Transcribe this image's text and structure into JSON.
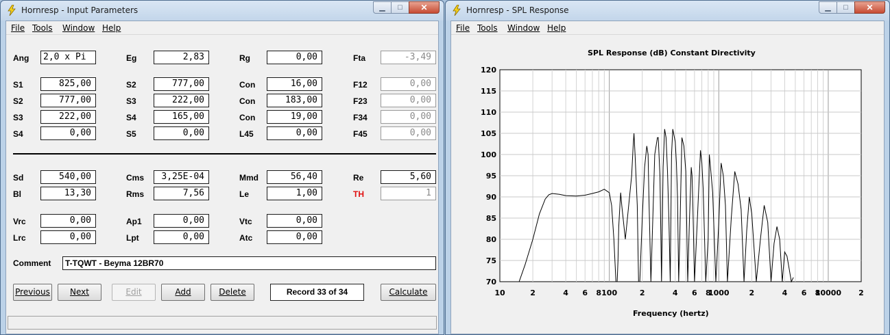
{
  "left_window": {
    "title": "Hornresp - Input Parameters",
    "menu": [
      "File",
      "Tools",
      "Window",
      "Help"
    ],
    "rows": [
      [
        {
          "label": "Ang",
          "value": "2,0 x Pi",
          "align": "left"
        },
        {
          "label": "Eg",
          "value": "2,83"
        },
        {
          "label": "Rg",
          "value": "0,00"
        },
        {
          "label": "Fta",
          "value": "-3,49",
          "disabled": true
        }
      ],
      [
        {
          "label": "S1",
          "value": "825,00"
        },
        {
          "label": "S2",
          "value": "777,00"
        },
        {
          "label": "Con",
          "value": "16,00"
        },
        {
          "label": "F12",
          "value": "0,00",
          "disabled": true
        }
      ],
      [
        {
          "label": "S2",
          "value": "777,00"
        },
        {
          "label": "S3",
          "value": "222,00"
        },
        {
          "label": "Con",
          "value": "183,00"
        },
        {
          "label": "F23",
          "value": "0,00",
          "disabled": true
        }
      ],
      [
        {
          "label": "S3",
          "value": "222,00"
        },
        {
          "label": "S4",
          "value": "165,00"
        },
        {
          "label": "Con",
          "value": "19,00"
        },
        {
          "label": "F34",
          "value": "0,00",
          "disabled": true
        }
      ],
      [
        {
          "label": "S4",
          "value": "0,00"
        },
        {
          "label": "S5",
          "value": "0,00"
        },
        {
          "label": "L45",
          "value": "0,00"
        },
        {
          "label": "F45",
          "value": "0,00",
          "disabled": true
        }
      ],
      [
        {
          "label": "Sd",
          "value": "540,00"
        },
        {
          "label": "Cms",
          "value": "3,25E-04"
        },
        {
          "label": "Mmd",
          "value": "56,40"
        },
        {
          "label": "Re",
          "value": "5,60"
        }
      ],
      [
        {
          "label": "Bl",
          "value": "13,30"
        },
        {
          "label": "Rms",
          "value": "7,56"
        },
        {
          "label": "Le",
          "value": "1,00"
        },
        {
          "label": "TH",
          "value": "1",
          "disabled": true,
          "red": true
        }
      ],
      [
        {
          "label": "Vrc",
          "value": "0,00"
        },
        {
          "label": "Ap1",
          "value": "0,00"
        },
        {
          "label": "Vtc",
          "value": "0,00"
        }
      ],
      [
        {
          "label": "Lrc",
          "value": "0,00"
        },
        {
          "label": "Lpt",
          "value": "0,00"
        },
        {
          "label": "Atc",
          "value": "0,00"
        }
      ]
    ],
    "comment_label": "Comment",
    "comment_value": "T-TQWT - Beyma 12BR70",
    "buttons": {
      "previous": "Previous",
      "next": "Next",
      "edit": "Edit",
      "add": "Add",
      "delete": "Delete",
      "calculate": "Calculate"
    },
    "record": "Record 33 of 34"
  },
  "right_window": {
    "title": "Hornresp - SPL Response",
    "menu": [
      "File",
      "Tools",
      "Window",
      "Help"
    ]
  },
  "chart_data": {
    "type": "line",
    "title": "SPL Response (dB)   Constant Directivity",
    "xlabel": "Frequency (hertz)",
    "ylabel": "",
    "xscale": "log",
    "xlim": [
      10,
      20000
    ],
    "ylim": [
      70,
      120
    ],
    "yticks": [
      70,
      75,
      80,
      85,
      90,
      95,
      100,
      105,
      110,
      115,
      120
    ],
    "xtick_labels": [
      {
        "f": 10,
        "t": "10"
      },
      {
        "f": 20,
        "t": "2"
      },
      {
        "f": 40,
        "t": "4"
      },
      {
        "f": 60,
        "t": "6"
      },
      {
        "f": 80,
        "t": "8"
      },
      {
        "f": 100,
        "t": "100"
      },
      {
        "f": 200,
        "t": "2"
      },
      {
        "f": 400,
        "t": "4"
      },
      {
        "f": 600,
        "t": "6"
      },
      {
        "f": 800,
        "t": "8"
      },
      {
        "f": 1000,
        "t": "1000"
      },
      {
        "f": 2000,
        "t": "2"
      },
      {
        "f": 4000,
        "t": "4"
      },
      {
        "f": 6000,
        "t": "6"
      },
      {
        "f": 8000,
        "t": "8"
      },
      {
        "f": 10000,
        "t": "10000"
      },
      {
        "f": 20000,
        "t": "2"
      }
    ],
    "grid": true,
    "series": [
      {
        "x": [
          10,
          12,
          15,
          17,
          20,
          23,
          26,
          28,
          30,
          35,
          40,
          50,
          60,
          70,
          80,
          90,
          100,
          105,
          110,
          115,
          118,
          120,
          122,
          125,
          127,
          130,
          140,
          160,
          165,
          168,
          172,
          180,
          185,
          190,
          200,
          210,
          220,
          226,
          230,
          240,
          260,
          275,
          280,
          290,
          300,
          310,
          320,
          330,
          340,
          350,
          360,
          370,
          380,
          400,
          410,
          420,
          430,
          440,
          450,
          460,
          480,
          500,
          520,
          540,
          560,
          570,
          580,
          600,
          640,
          680,
          700,
          720,
          760,
          800,
          820,
          840,
          880,
          940,
          1000,
          1050,
          1100,
          1150,
          1200,
          1300,
          1400,
          1500,
          1600,
          1700,
          1800,
          1900,
          2000,
          2200,
          2400,
          2600,
          2800,
          3000,
          3200,
          3400,
          3600,
          3800,
          4000,
          4200,
          4400,
          4600,
          4800
        ],
        "y": [
          70,
          70,
          70,
          74,
          80,
          86,
          89.5,
          90.5,
          90.8,
          90.6,
          90.3,
          90.2,
          90.4,
          90.8,
          91.2,
          91.8,
          91,
          88,
          80,
          70,
          70,
          75,
          83,
          88,
          91,
          88,
          80,
          95,
          102,
          105,
          100,
          88,
          70,
          70,
          85,
          97,
          102,
          100,
          90,
          70,
          100,
          104,
          104,
          95,
          70,
          97,
          106,
          104,
          96,
          85,
          70,
          100,
          106,
          103,
          98,
          90,
          70,
          80,
          92,
          104,
          102,
          96,
          70,
          85,
          97,
          95,
          88,
          70,
          86,
          101,
          98,
          92,
          70,
          80,
          100,
          97,
          91,
          70,
          84,
          98,
          95,
          88,
          70,
          85,
          96,
          93,
          87,
          70,
          82,
          90,
          86,
          70,
          80,
          88,
          84,
          70,
          79,
          83,
          80,
          70,
          77,
          76,
          73,
          70,
          71
        ]
      }
    ]
  }
}
